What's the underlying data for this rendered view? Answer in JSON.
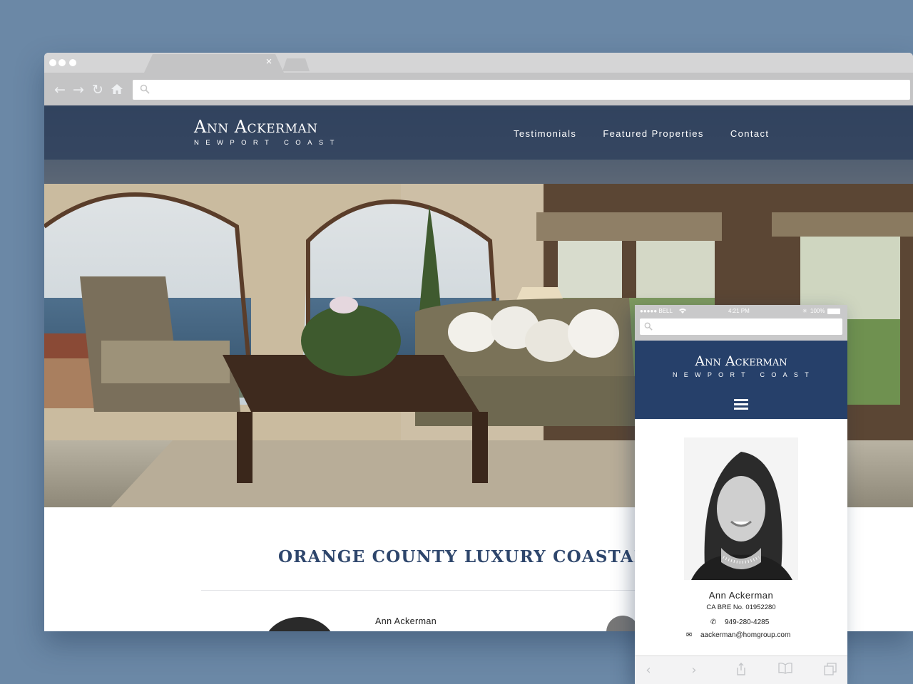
{
  "browser": {
    "tab_close": "×",
    "nav_icons": [
      "back-arrow-icon",
      "forward-arrow-icon",
      "reload-icon",
      "home-icon",
      "search-icon"
    ]
  },
  "site": {
    "logo": {
      "name": "Ann Ackerman",
      "tagline": "NEWPORT COAST"
    },
    "nav": [
      {
        "label": "Testimonials"
      },
      {
        "label": "Featured Properties"
      },
      {
        "label": "Contact"
      }
    ],
    "headline": "ORANGE COUNTY LUXURY COASTAL REAL",
    "agent": {
      "name": "Ann Ackerman"
    }
  },
  "mobile": {
    "status": {
      "carrier": "●●●●● BELL",
      "time": "4:21 PM",
      "battery": "100%"
    },
    "logo": {
      "name": "Ann Ackerman",
      "tagline": "NEWPORT COAST"
    },
    "agent": {
      "name": "Ann Ackerman",
      "license": "CA BRE No. 01952280",
      "phone": "949-280-4285",
      "email": "aackerman@homgroup.com"
    }
  },
  "colors": {
    "background": "#6b88a6",
    "header_navy": "#26406a",
    "headline": "#2e466c"
  }
}
